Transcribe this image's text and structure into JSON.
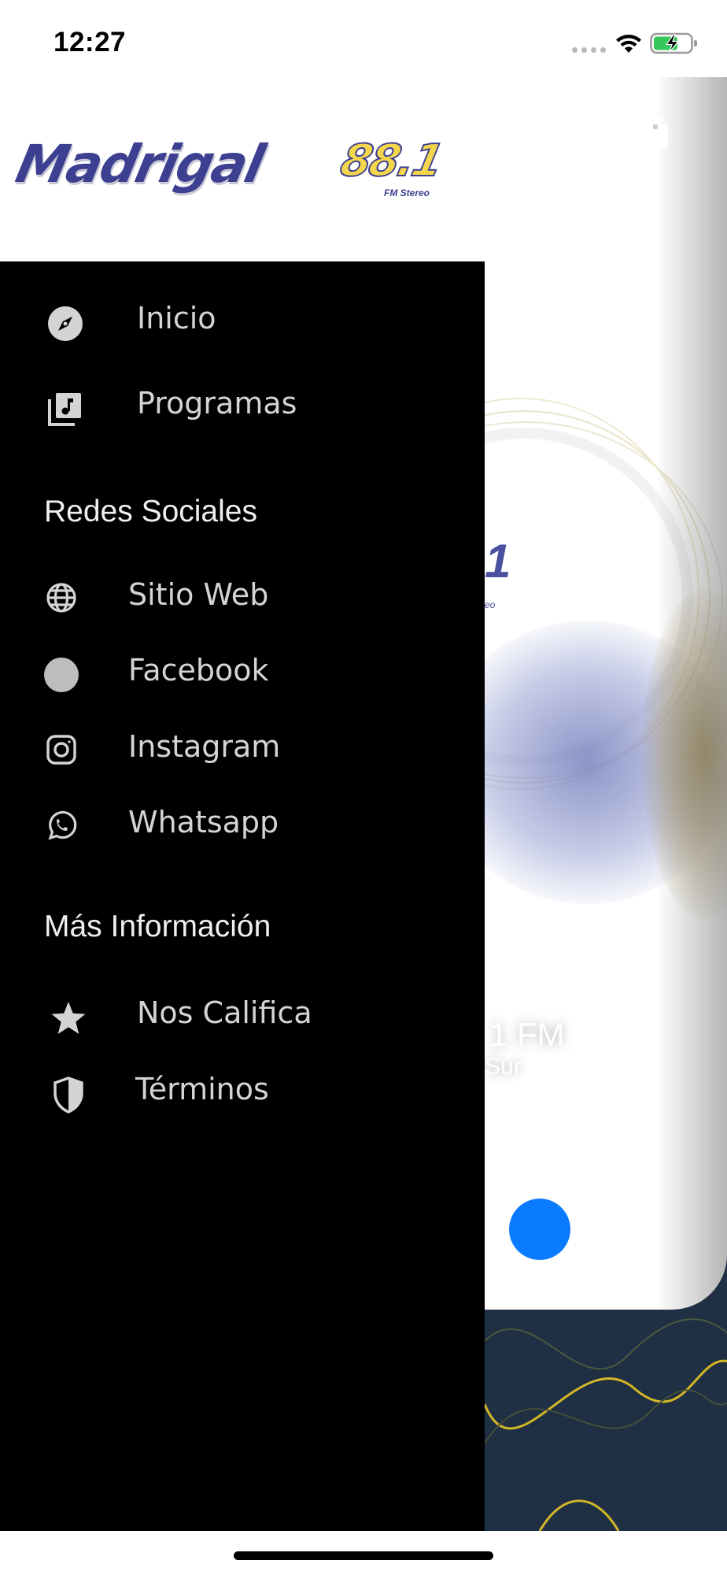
{
  "status_bar": {
    "time": "12:27"
  },
  "drawer": {
    "logo": {
      "wordmark": "Madrigal",
      "frequency": "88.1",
      "tagline": "FM Stereo"
    },
    "main_items": [
      {
        "label": "Inicio",
        "icon": "compass-icon"
      },
      {
        "label": "Programas",
        "icon": "music-library-icon"
      }
    ],
    "sections": [
      {
        "title": "Redes Sociales",
        "items": [
          {
            "label": "Sitio  Web",
            "icon": "globe-icon"
          },
          {
            "label": "Facebook",
            "icon": "facebook-icon"
          },
          {
            "label": "Instagram",
            "icon": "instagram-icon"
          },
          {
            "label": "Whatsapp",
            "icon": "whatsapp-icon"
          }
        ]
      },
      {
        "title": "Más Información",
        "items": [
          {
            "label": "Nos  Califica",
            "icon": "star-icon"
          },
          {
            "label": "Términos",
            "icon": "shield-icon"
          }
        ]
      }
    ]
  },
  "background_app": {
    "logo_fragment": "1",
    "logo_fragment_sub": "eo",
    "station_name_fragment": "1  FM",
    "station_sub_fragment": "Sur",
    "share_icon": "share-icon",
    "play_icon": "play-button"
  },
  "colors": {
    "drawer_bg": "#000000",
    "menu_text": "#d4d4d4",
    "section_title": "#efefef",
    "brand_blue": "#3d3f91",
    "brand_yellow": "#f3d64b",
    "play_button": "#0a7bff",
    "footer_bg": "#1f2f44"
  }
}
